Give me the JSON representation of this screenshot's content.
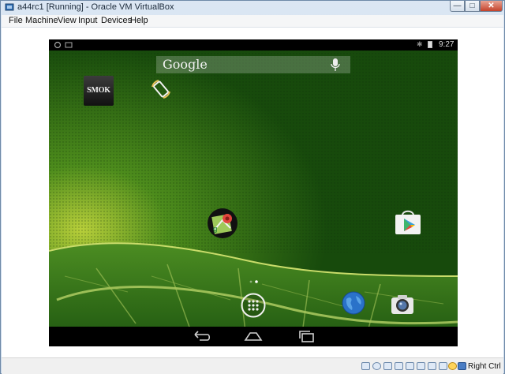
{
  "window": {
    "title": "a44rc1 [Running] - Oracle VM VirtualBox",
    "controls": {
      "minimize": "—",
      "maximize": "□",
      "close": "✕"
    }
  },
  "menubar": {
    "items": [
      "File",
      "Machine",
      "View",
      "Input",
      "Devices",
      "Help"
    ]
  },
  "android": {
    "statusbar": {
      "time": "9:27",
      "bluetooth_glyph": "✱"
    },
    "search": {
      "label": "Google"
    },
    "apps": {
      "smok_label": "SMOK"
    }
  },
  "statusbar": {
    "icons": [
      "hard-disk-icon",
      "optical-drive-icon",
      "network-icon",
      "usb-icon",
      "shared-folders-icon",
      "display-icon",
      "video-capture-icon",
      "virtualization-icon",
      "mouse-integration-icon",
      "host-key-icon"
    ],
    "host_key": "Right Ctrl"
  }
}
